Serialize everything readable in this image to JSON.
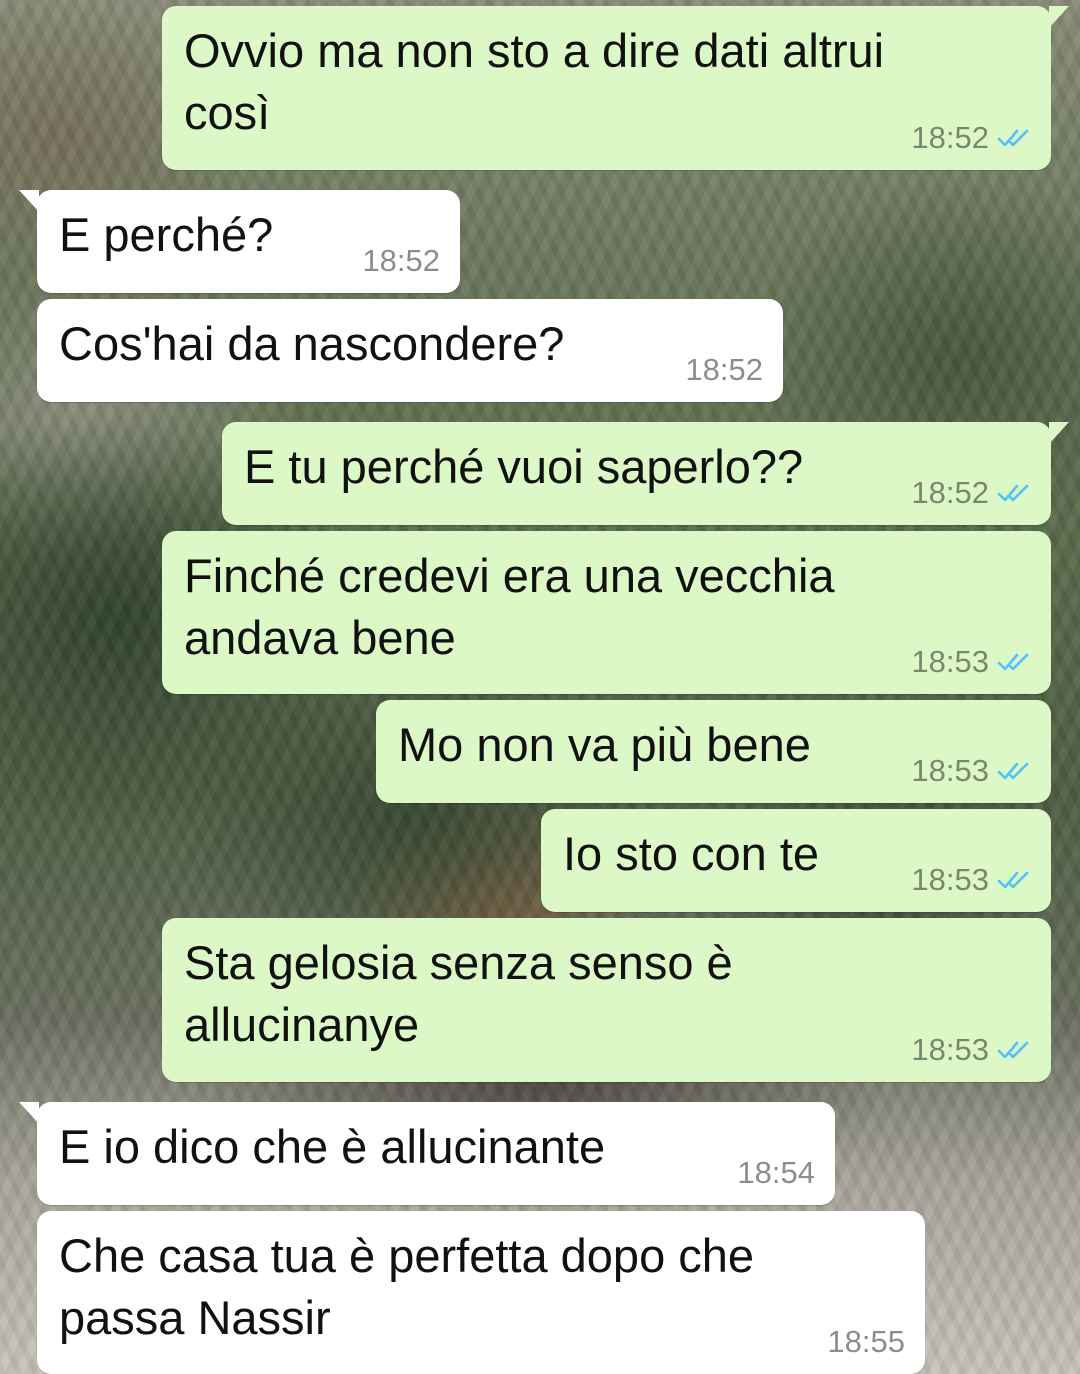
{
  "colors": {
    "outgoing_bubble": "#dcf8c6",
    "incoming_bubble": "#ffffff",
    "read_ticks": "#4fc3f7",
    "timestamp": "#8a8a8a"
  },
  "messages": [
    {
      "direction": "out",
      "text": "Ovvio ma non sto a dire dati altrui\ncosì",
      "time": "18:52",
      "status": "read-double-check-icon"
    },
    {
      "direction": "in",
      "text": "E perché?",
      "time": "18:52"
    },
    {
      "direction": "in",
      "text": "Cos'hai da nascondere?",
      "time": "18:52"
    },
    {
      "direction": "out",
      "text": "E tu perché vuoi saperlo??",
      "time": "18:52",
      "status": "read-double-check-icon"
    },
    {
      "direction": "out",
      "text": "Finché credevi era una vecchia\nandava bene",
      "time": "18:53",
      "status": "read-double-check-icon"
    },
    {
      "direction": "out",
      "text": "Mo non va più bene",
      "time": "18:53",
      "status": "read-double-check-icon"
    },
    {
      "direction": "out",
      "text": "Io sto con te",
      "time": "18:53",
      "status": "read-double-check-icon"
    },
    {
      "direction": "out",
      "text": "Sta gelosia senza senso è\nallucinanye",
      "time": "18:53",
      "status": "read-double-check-icon"
    },
    {
      "direction": "in",
      "text": "E io dico che è allucinante",
      "time": "18:54"
    },
    {
      "direction": "in",
      "text": "Che casa tua è perfetta dopo che\npassa Nassir",
      "time": "18:55"
    }
  ]
}
